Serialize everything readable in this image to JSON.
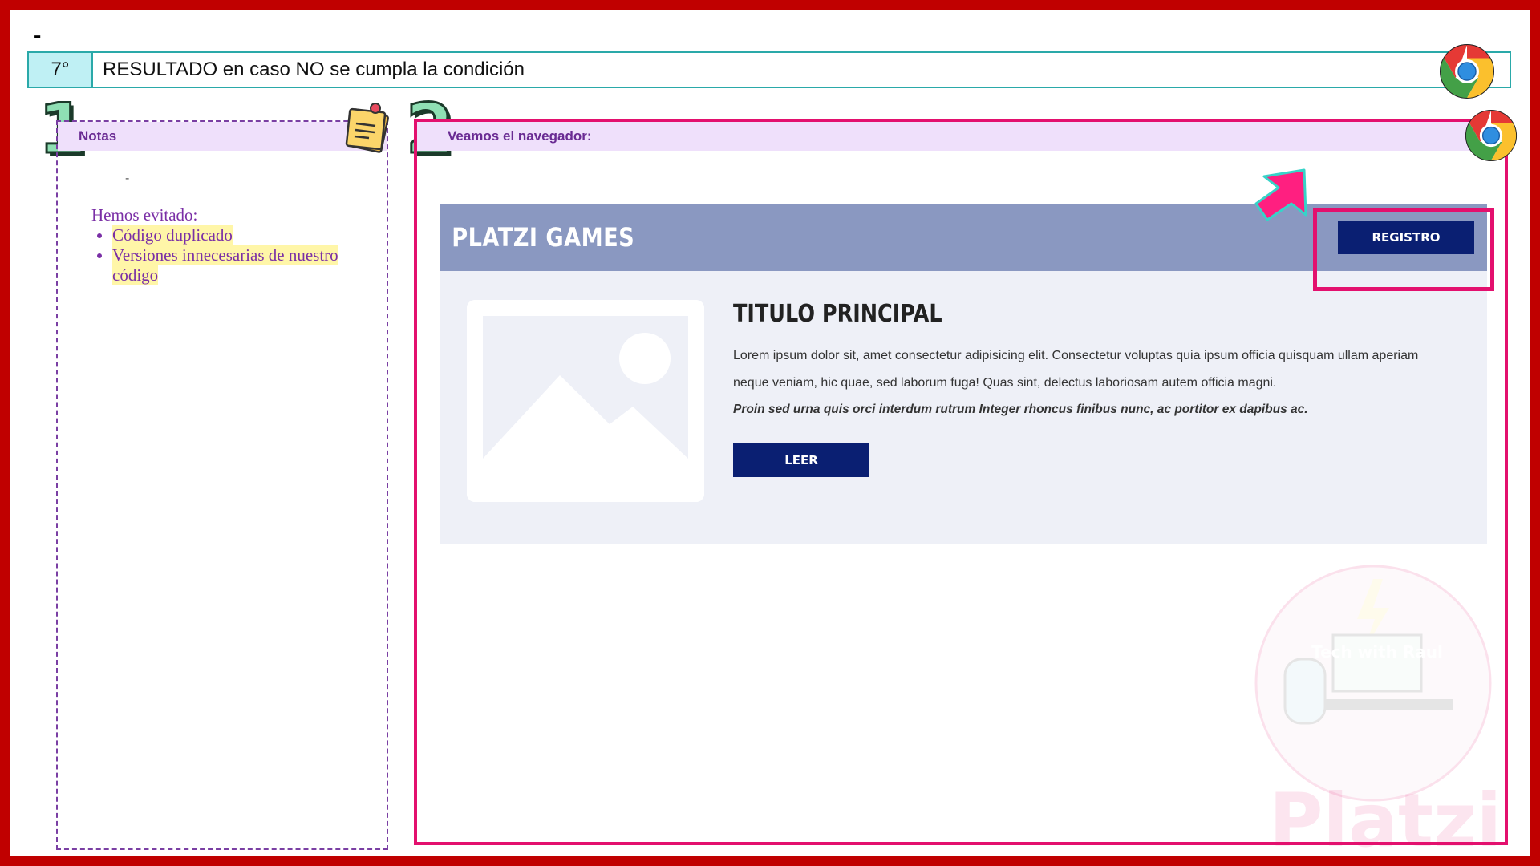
{
  "slide": {
    "top_mark": "-",
    "step": {
      "number": "7°",
      "title": "RESULTADO en caso NO se cumpla la condición"
    }
  },
  "notes": {
    "section_number": "1",
    "header": "Notas",
    "dash": "-",
    "intro": "Hemos evitado:",
    "items": [
      "Código duplicado",
      "Versiones innecesarias de nuestro código"
    ]
  },
  "browser": {
    "section_number": "2",
    "header": "Veamos el navegador:",
    "site": {
      "brand": "PLATZI GAMES",
      "register_button": "REGISTRO",
      "title": "TITULO PRINCIPAL",
      "paragraph": "Lorem ipsum dolor sit, amet consectetur adipisicing elit. Consectetur voluptas quia ipsum officia quisquam ullam aperiam neque veniam, hic quae, sed laborum fuga! Quas sint, delectus laboriosam autem officia magni.",
      "emphasis": "Proin sed urna quis orci interdum rutrum Integer rhoncus finibus nunc, ac portitor ex dapibus ac.",
      "read_button": "LEER"
    }
  },
  "watermark": {
    "badge_text": "Tech with Raul",
    "brand": "Platzi"
  },
  "colors": {
    "frame": "#c00000",
    "accent_pink": "#e3106e",
    "nav_bar": "#8a98c1",
    "button": "#0a1f72",
    "notes_text": "#7a2fa6"
  },
  "icons": [
    "chrome-icon",
    "sticky-note-icon",
    "arrow-icon",
    "image-placeholder-icon"
  ]
}
